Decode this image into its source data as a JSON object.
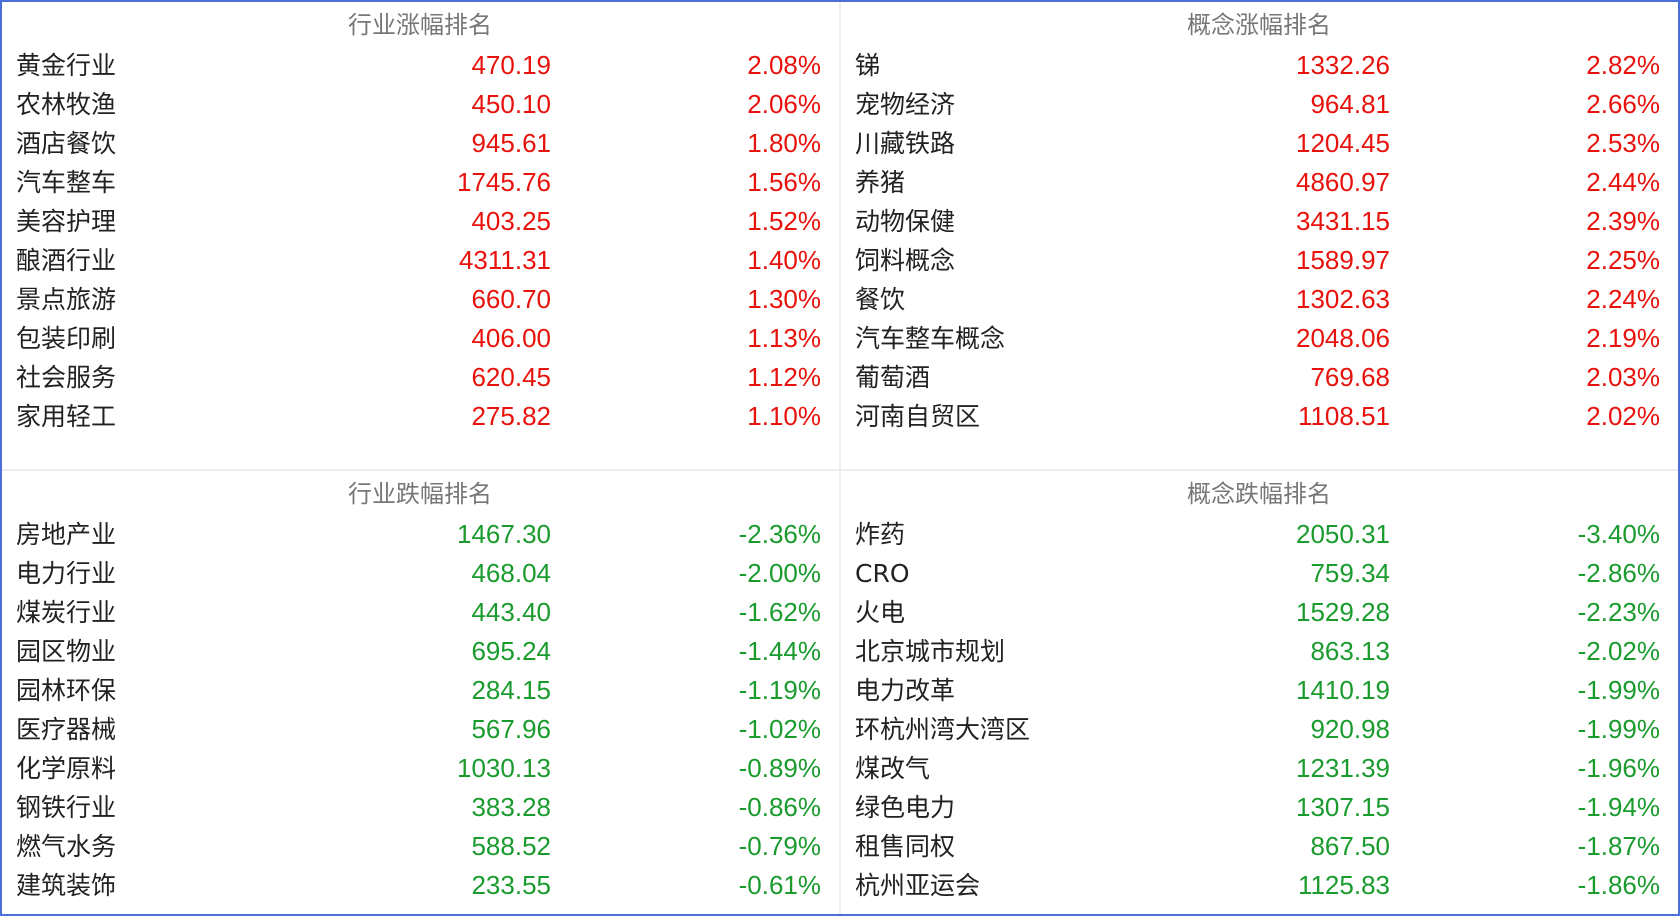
{
  "colors": {
    "up": "#e8120c",
    "down": "#1a9b2e",
    "border": "#4a6fd8",
    "title": "#777777"
  },
  "panels": [
    {
      "id": "industry-gain",
      "title": "行业涨幅排名",
      "trend": "up",
      "rows": [
        {
          "name": "黄金行业",
          "value": "470.19",
          "change": "2.08%"
        },
        {
          "name": "农林牧渔",
          "value": "450.10",
          "change": "2.06%"
        },
        {
          "name": "酒店餐饮",
          "value": "945.61",
          "change": "1.80%"
        },
        {
          "name": "汽车整车",
          "value": "1745.76",
          "change": "1.56%"
        },
        {
          "name": "美容护理",
          "value": "403.25",
          "change": "1.52%"
        },
        {
          "name": "酿酒行业",
          "value": "4311.31",
          "change": "1.40%"
        },
        {
          "name": "景点旅游",
          "value": "660.70",
          "change": "1.30%"
        },
        {
          "name": "包装印刷",
          "value": "406.00",
          "change": "1.13%"
        },
        {
          "name": "社会服务",
          "value": "620.45",
          "change": "1.12%"
        },
        {
          "name": "家用轻工",
          "value": "275.82",
          "change": "1.10%"
        }
      ]
    },
    {
      "id": "concept-gain",
      "title": "概念涨幅排名",
      "trend": "up",
      "rows": [
        {
          "name": "锑",
          "value": "1332.26",
          "change": "2.82%"
        },
        {
          "name": "宠物经济",
          "value": "964.81",
          "change": "2.66%"
        },
        {
          "name": "川藏铁路",
          "value": "1204.45",
          "change": "2.53%"
        },
        {
          "name": "养猪",
          "value": "4860.97",
          "change": "2.44%"
        },
        {
          "name": "动物保健",
          "value": "3431.15",
          "change": "2.39%"
        },
        {
          "name": "饲料概念",
          "value": "1589.97",
          "change": "2.25%"
        },
        {
          "name": "餐饮",
          "value": "1302.63",
          "change": "2.24%"
        },
        {
          "name": "汽车整车概念",
          "value": "2048.06",
          "change": "2.19%"
        },
        {
          "name": "葡萄酒",
          "value": "769.68",
          "change": "2.03%"
        },
        {
          "name": "河南自贸区",
          "value": "1108.51",
          "change": "2.02%"
        }
      ]
    },
    {
      "id": "industry-loss",
      "title": "行业跌幅排名",
      "trend": "down",
      "rows": [
        {
          "name": "房地产业",
          "value": "1467.30",
          "change": "-2.36%"
        },
        {
          "name": "电力行业",
          "value": "468.04",
          "change": "-2.00%"
        },
        {
          "name": "煤炭行业",
          "value": "443.40",
          "change": "-1.62%"
        },
        {
          "name": "园区物业",
          "value": "695.24",
          "change": "-1.44%"
        },
        {
          "name": "园林环保",
          "value": "284.15",
          "change": "-1.19%"
        },
        {
          "name": "医疗器械",
          "value": "567.96",
          "change": "-1.02%"
        },
        {
          "name": "化学原料",
          "value": "1030.13",
          "change": "-0.89%"
        },
        {
          "name": "钢铁行业",
          "value": "383.28",
          "change": "-0.86%"
        },
        {
          "name": "燃气水务",
          "value": "588.52",
          "change": "-0.79%"
        },
        {
          "name": "建筑装饰",
          "value": "233.55",
          "change": "-0.61%"
        }
      ]
    },
    {
      "id": "concept-loss",
      "title": "概念跌幅排名",
      "trend": "down",
      "rows": [
        {
          "name": "炸药",
          "value": "2050.31",
          "change": "-3.40%"
        },
        {
          "name": "CRO",
          "value": "759.34",
          "change": "-2.86%"
        },
        {
          "name": "火电",
          "value": "1529.28",
          "change": "-2.23%"
        },
        {
          "name": "北京城市规划",
          "value": "863.13",
          "change": "-2.02%"
        },
        {
          "name": "电力改革",
          "value": "1410.19",
          "change": "-1.99%"
        },
        {
          "name": "环杭州湾大湾区",
          "value": "920.98",
          "change": "-1.99%"
        },
        {
          "name": "煤改气",
          "value": "1231.39",
          "change": "-1.96%"
        },
        {
          "name": "绿色电力",
          "value": "1307.15",
          "change": "-1.94%"
        },
        {
          "name": "租售同权",
          "value": "867.50",
          "change": "-1.87%"
        },
        {
          "name": "杭州亚运会",
          "value": "1125.83",
          "change": "-1.86%"
        }
      ]
    }
  ]
}
